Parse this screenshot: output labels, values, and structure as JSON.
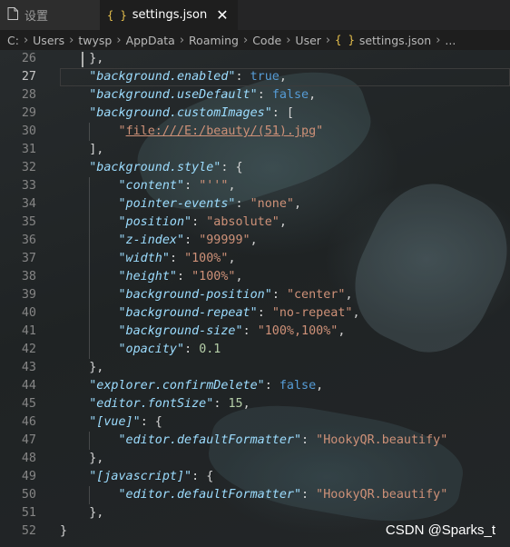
{
  "tabs": [
    {
      "label": "设置",
      "icon": "file-icon",
      "active": false
    },
    {
      "label": "settings.json",
      "icon": "json-braces-icon",
      "active": true
    }
  ],
  "breadcrumb": [
    "C:",
    "Users",
    "twysp",
    "AppData",
    "Roaming",
    "Code",
    "User",
    "settings.json",
    "..."
  ],
  "watermark": "CSDN @Sparks_t",
  "current_line": 27,
  "code_lines": [
    {
      "n": "26",
      "tokens": [
        {
          "t": "    },",
          "c": "punc"
        }
      ]
    },
    {
      "n": "27",
      "tokens": [
        {
          "t": "    ",
          "c": "punc"
        },
        {
          "t": "\"background.enabled\"",
          "c": "key"
        },
        {
          "t": ": ",
          "c": "punc"
        },
        {
          "t": "true",
          "c": "lit"
        },
        {
          "t": ",",
          "c": "punc"
        }
      ]
    },
    {
      "n": "28",
      "tokens": [
        {
          "t": "    ",
          "c": "punc"
        },
        {
          "t": "\"background.useDefault\"",
          "c": "key"
        },
        {
          "t": ": ",
          "c": "punc"
        },
        {
          "t": "false",
          "c": "lit"
        },
        {
          "t": ",",
          "c": "punc"
        }
      ]
    },
    {
      "n": "29",
      "tokens": [
        {
          "t": "    ",
          "c": "punc"
        },
        {
          "t": "\"background.customImages\"",
          "c": "key"
        },
        {
          "t": ": [",
          "c": "punc"
        }
      ]
    },
    {
      "n": "30",
      "tokens": [
        {
          "t": "        \"",
          "c": "str"
        },
        {
          "t": "file:///E:/beauty/(51).jpg",
          "c": "link"
        },
        {
          "t": "\"",
          "c": "str"
        }
      ]
    },
    {
      "n": "31",
      "tokens": [
        {
          "t": "    ],",
          "c": "punc"
        }
      ]
    },
    {
      "n": "32",
      "tokens": [
        {
          "t": "    ",
          "c": "punc"
        },
        {
          "t": "\"background.style\"",
          "c": "key"
        },
        {
          "t": ": {",
          "c": "punc"
        }
      ]
    },
    {
      "n": "33",
      "tokens": [
        {
          "t": "        ",
          "c": "punc"
        },
        {
          "t": "\"content\"",
          "c": "key"
        },
        {
          "t": ": ",
          "c": "punc"
        },
        {
          "t": "\"''\"",
          "c": "str"
        },
        {
          "t": ",",
          "c": "punc"
        }
      ]
    },
    {
      "n": "34",
      "tokens": [
        {
          "t": "        ",
          "c": "punc"
        },
        {
          "t": "\"pointer-events\"",
          "c": "key"
        },
        {
          "t": ": ",
          "c": "punc"
        },
        {
          "t": "\"none\"",
          "c": "str"
        },
        {
          "t": ",",
          "c": "punc"
        }
      ]
    },
    {
      "n": "35",
      "tokens": [
        {
          "t": "        ",
          "c": "punc"
        },
        {
          "t": "\"position\"",
          "c": "key"
        },
        {
          "t": ": ",
          "c": "punc"
        },
        {
          "t": "\"absolute\"",
          "c": "str"
        },
        {
          "t": ",",
          "c": "punc"
        }
      ]
    },
    {
      "n": "36",
      "tokens": [
        {
          "t": "        ",
          "c": "punc"
        },
        {
          "t": "\"z-index\"",
          "c": "key"
        },
        {
          "t": ": ",
          "c": "punc"
        },
        {
          "t": "\"99999\"",
          "c": "str"
        },
        {
          "t": ",",
          "c": "punc"
        }
      ]
    },
    {
      "n": "37",
      "tokens": [
        {
          "t": "        ",
          "c": "punc"
        },
        {
          "t": "\"width\"",
          "c": "key"
        },
        {
          "t": ": ",
          "c": "punc"
        },
        {
          "t": "\"100%\"",
          "c": "str"
        },
        {
          "t": ",",
          "c": "punc"
        }
      ]
    },
    {
      "n": "38",
      "tokens": [
        {
          "t": "        ",
          "c": "punc"
        },
        {
          "t": "\"height\"",
          "c": "key"
        },
        {
          "t": ": ",
          "c": "punc"
        },
        {
          "t": "\"100%\"",
          "c": "str"
        },
        {
          "t": ",",
          "c": "punc"
        }
      ]
    },
    {
      "n": "39",
      "tokens": [
        {
          "t": "        ",
          "c": "punc"
        },
        {
          "t": "\"background-position\"",
          "c": "key"
        },
        {
          "t": ": ",
          "c": "punc"
        },
        {
          "t": "\"center\"",
          "c": "str"
        },
        {
          "t": ",",
          "c": "punc"
        }
      ]
    },
    {
      "n": "40",
      "tokens": [
        {
          "t": "        ",
          "c": "punc"
        },
        {
          "t": "\"background-repeat\"",
          "c": "key"
        },
        {
          "t": ": ",
          "c": "punc"
        },
        {
          "t": "\"no-repeat\"",
          "c": "str"
        },
        {
          "t": ",",
          "c": "punc"
        }
      ]
    },
    {
      "n": "41",
      "tokens": [
        {
          "t": "        ",
          "c": "punc"
        },
        {
          "t": "\"background-size\"",
          "c": "key"
        },
        {
          "t": ": ",
          "c": "punc"
        },
        {
          "t": "\"100%,100%\"",
          "c": "str"
        },
        {
          "t": ",",
          "c": "punc"
        }
      ]
    },
    {
      "n": "42",
      "tokens": [
        {
          "t": "        ",
          "c": "punc"
        },
        {
          "t": "\"opacity\"",
          "c": "key"
        },
        {
          "t": ": ",
          "c": "punc"
        },
        {
          "t": "0.1",
          "c": "num"
        }
      ]
    },
    {
      "n": "43",
      "tokens": [
        {
          "t": "    },",
          "c": "punc"
        }
      ]
    },
    {
      "n": "44",
      "tokens": [
        {
          "t": "    ",
          "c": "punc"
        },
        {
          "t": "\"explorer.confirmDelete\"",
          "c": "key"
        },
        {
          "t": ": ",
          "c": "punc"
        },
        {
          "t": "false",
          "c": "lit"
        },
        {
          "t": ",",
          "c": "punc"
        }
      ]
    },
    {
      "n": "45",
      "tokens": [
        {
          "t": "    ",
          "c": "punc"
        },
        {
          "t": "\"editor.fontSize\"",
          "c": "key"
        },
        {
          "t": ": ",
          "c": "punc"
        },
        {
          "t": "15",
          "c": "num"
        },
        {
          "t": ",",
          "c": "punc"
        }
      ]
    },
    {
      "n": "46",
      "tokens": [
        {
          "t": "    ",
          "c": "punc"
        },
        {
          "t": "\"[vue]\"",
          "c": "key"
        },
        {
          "t": ": {",
          "c": "punc"
        }
      ]
    },
    {
      "n": "47",
      "tokens": [
        {
          "t": "        ",
          "c": "punc"
        },
        {
          "t": "\"editor.defaultFormatter\"",
          "c": "key"
        },
        {
          "t": ": ",
          "c": "punc"
        },
        {
          "t": "\"HookyQR.beautify\"",
          "c": "str"
        }
      ]
    },
    {
      "n": "48",
      "tokens": [
        {
          "t": "    },",
          "c": "punc"
        }
      ]
    },
    {
      "n": "49",
      "tokens": [
        {
          "t": "    ",
          "c": "punc"
        },
        {
          "t": "\"[javascript]\"",
          "c": "key"
        },
        {
          "t": ": {",
          "c": "punc"
        }
      ]
    },
    {
      "n": "50",
      "tokens": [
        {
          "t": "        ",
          "c": "punc"
        },
        {
          "t": "\"editor.defaultFormatter\"",
          "c": "key"
        },
        {
          "t": ": ",
          "c": "punc"
        },
        {
          "t": "\"HookyQR.beautify\"",
          "c": "str"
        }
      ]
    },
    {
      "n": "51",
      "tokens": [
        {
          "t": "    },",
          "c": "punc"
        }
      ]
    },
    {
      "n": "52",
      "tokens": [
        {
          "t": "}",
          "c": "punc"
        }
      ]
    }
  ],
  "colors": {
    "key": "#9cdcfe",
    "string": "#ce9178",
    "literal": "#569cd6",
    "number": "#b5cea8",
    "json_icon": "#e8c14d"
  }
}
